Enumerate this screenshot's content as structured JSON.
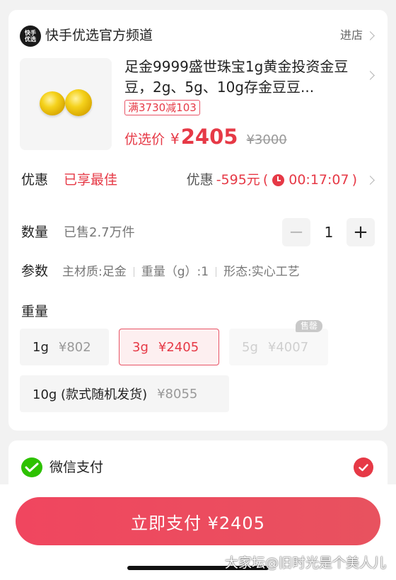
{
  "store": {
    "logo_text": "快手优选",
    "name": "快手优选官方频道",
    "enter_label": "进店"
  },
  "product": {
    "title": "足金9999盛世珠宝1g黄金投资金豆豆，2g、5g、10g存金豆豆...",
    "promo_tag": "满3730减103",
    "price_label": "优选价",
    "currency": "¥",
    "price": "2405",
    "original_price": "¥3000"
  },
  "discount": {
    "label": "优惠",
    "best": "已享最佳",
    "prefix": "优惠",
    "amount": "-595元",
    "paren_open": "(",
    "countdown": "00:17:07",
    "paren_close": ")"
  },
  "quantity": {
    "label": "数量",
    "sold": "已售2.7万件",
    "minus": "−",
    "value": "1",
    "plus": "+"
  },
  "params": {
    "label": "参数",
    "items": [
      "主材质:足金",
      "重量（g）:1",
      "形态:实心工艺"
    ]
  },
  "weight": {
    "label": "重量",
    "options": [
      {
        "name": "1g",
        "price": "¥802",
        "state": "normal"
      },
      {
        "name": "3g",
        "price": "¥2405",
        "state": "selected"
      },
      {
        "name": "5g",
        "price": "¥4007",
        "state": "disabled"
      },
      {
        "name": "10g (款式随机发货)",
        "price": "¥8055",
        "state": "normal"
      }
    ],
    "soldout_badge": "售罄"
  },
  "payment": {
    "method": "微信支付"
  },
  "pay_button": "立即支付 ¥2405",
  "watermark": "大家坛@旧时光是个美人儿",
  "colors": {
    "accent": "#e63946",
    "wechat": "#2dc100"
  }
}
